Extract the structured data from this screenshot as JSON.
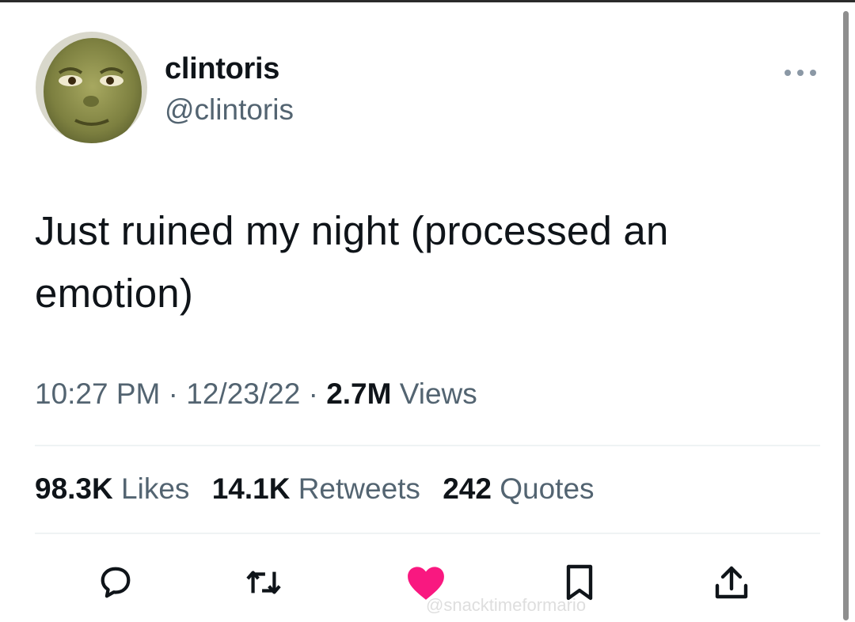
{
  "tweet": {
    "author": {
      "display_name": "clintoris",
      "handle": "@clintoris"
    },
    "text": "Just ruined my night (processed an emotion)",
    "meta": {
      "time": "10:27 PM",
      "separator": "·",
      "date": "12/23/22",
      "views_count": "2.7M",
      "views_label": "Views"
    },
    "stats": {
      "likes_count": "98.3K",
      "likes_label": "Likes",
      "retweets_count": "14.1K",
      "retweets_label": "Retweets",
      "quotes_count": "242",
      "quotes_label": "Quotes"
    },
    "actions": {
      "reply_icon": "reply-icon",
      "retweet_icon": "retweet-icon",
      "like_icon": "heart-icon",
      "bookmark_icon": "bookmark-icon",
      "share_icon": "share-icon"
    },
    "colors": {
      "liked_heart": "#f91880",
      "secondary_text": "#536471",
      "primary_text": "#0f1419"
    }
  },
  "watermark": {
    "text": "@snacktimeformario"
  }
}
